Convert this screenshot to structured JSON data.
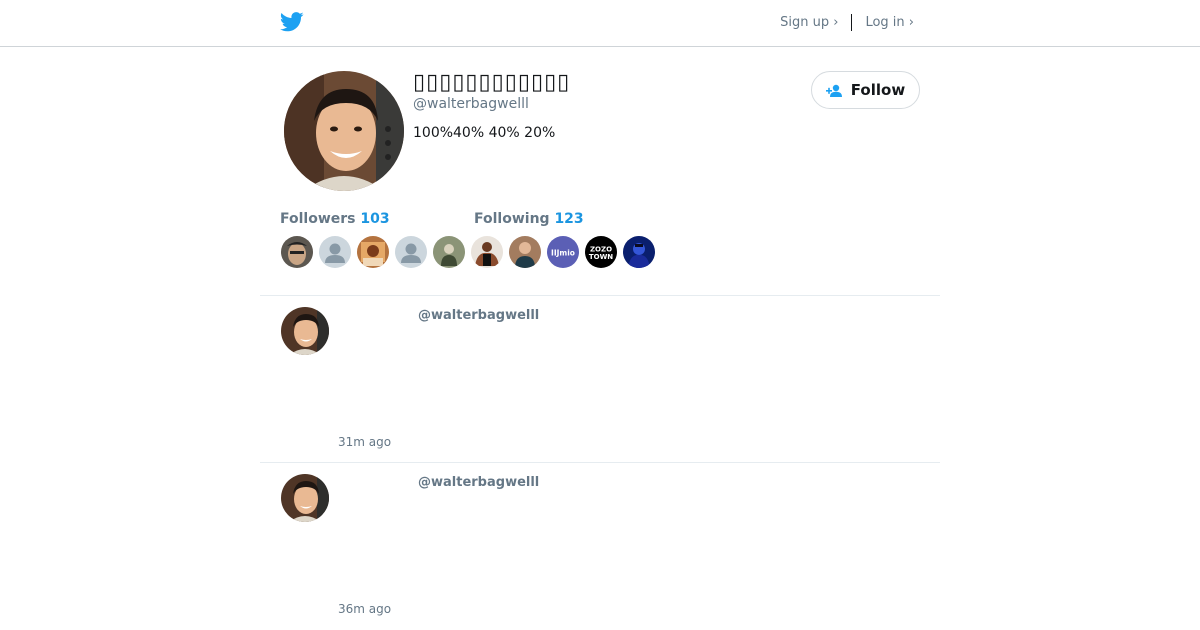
{
  "header": {
    "logo_icon": "twitter-bird-icon",
    "brand_color": "#1da1f2",
    "signup_label": "Sign up ›",
    "login_label": "Log in ›"
  },
  "profile": {
    "display_name": "▯▯▯▯▯▯▯▯▯▯▯▯",
    "handle": "@walterbagwelll",
    "bio": "100%40% 40% 20%",
    "follow_label": "Follow",
    "follow_icon": "add-user-icon"
  },
  "stats": {
    "followers_label": "Followers",
    "followers_count": "103",
    "following_label": "Following",
    "following_count": "123",
    "accent_color": "#1b95e0"
  },
  "mini_avatars": [
    {
      "icon": "user-photo"
    },
    {
      "icon": "default-user-icon"
    },
    {
      "icon": "user-photo"
    },
    {
      "icon": "default-user-icon"
    },
    {
      "icon": "user-photo"
    },
    {
      "icon": "user-photo"
    },
    {
      "icon": "user-photo"
    },
    {
      "text": "IIJmio"
    },
    {
      "text_line1": "ZOZO",
      "text_line2": "TOWN"
    },
    {
      "icon": "user-photo"
    }
  ],
  "tweets": [
    {
      "handle": "@walterbagwelll",
      "time": "31m ago"
    },
    {
      "handle": "@walterbagwelll",
      "time": "36m ago"
    }
  ]
}
